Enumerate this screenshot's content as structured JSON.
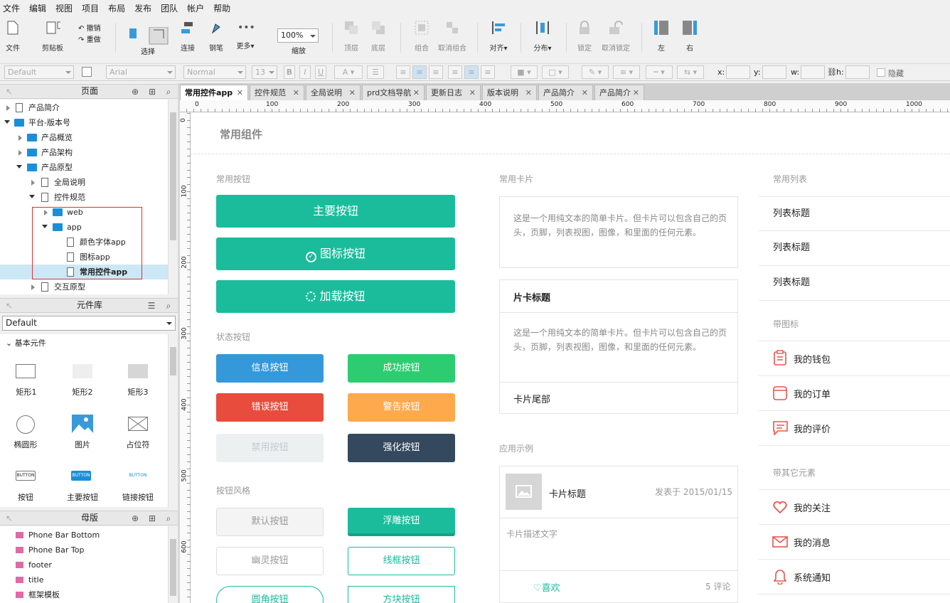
{
  "menu": [
    "文件",
    "编辑",
    "视图",
    "项目",
    "布局",
    "发布",
    "团队",
    "帐户",
    "帮助"
  ],
  "toolbar": {
    "file": "文件",
    "clipboard": "剪贴板",
    "undo": "撤销",
    "redo": "重做",
    "select": "选择",
    "connect": "连接",
    "pen": "钢笔",
    "more": "更多▾",
    "zoom_value": "100%",
    "zoom": "缩放",
    "top": "顶层",
    "bottom": "底层",
    "group": "组合",
    "ungroup": "取消组合",
    "align": "对齐▾",
    "distribute": "分布▾",
    "lock": "锁定",
    "unlock": "取消锁定",
    "left": "左",
    "right": "右"
  },
  "format": {
    "style": "Default",
    "font": "Arial",
    "weight": "Normal",
    "size": "13",
    "x_label": "x:",
    "y_label": "y:",
    "w_label": "w:",
    "h_label": "h:",
    "hide": "隐藏"
  },
  "pages_panel": {
    "title": "页面",
    "items": [
      {
        "label": "产品简介",
        "type": "page"
      },
      {
        "label": "平台-版本号",
        "type": "folder"
      },
      {
        "label": "产品概览",
        "type": "folder"
      },
      {
        "label": "产品架构",
        "type": "folder"
      },
      {
        "label": "产品原型",
        "type": "folder"
      },
      {
        "label": "全局说明",
        "type": "page"
      },
      {
        "label": "控件规范",
        "type": "page"
      },
      {
        "label": "web",
        "type": "folder"
      },
      {
        "label": "app",
        "type": "folder"
      },
      {
        "label": "颜色字体app",
        "type": "page"
      },
      {
        "label": "图标app",
        "type": "page"
      },
      {
        "label": "常用控件app",
        "type": "page"
      },
      {
        "label": "交互原型",
        "type": "page"
      }
    ]
  },
  "library_panel": {
    "title": "元件库",
    "selected": "Default",
    "group": "基本元件",
    "widgets": [
      "矩形1",
      "矩形2",
      "矩形3",
      "椭圆形",
      "图片",
      "占位符",
      "按钮",
      "主要按钮",
      "链接按钮"
    ],
    "btn_sample": "BUTTON"
  },
  "masters_panel": {
    "title": "母版",
    "items": [
      "Phone Bar Bottom",
      "Phone Bar Top",
      "footer",
      "title",
      "框架模板"
    ]
  },
  "tabs": [
    "常用控件app",
    "控件规范",
    "全局说明",
    "prd文档导航",
    "更新日志",
    "版本说明",
    "产品简介",
    "产品简介"
  ],
  "ruler_h": [
    "0",
    "100",
    "200",
    "300",
    "400",
    "500",
    "600",
    "700",
    "800",
    "900",
    "1000"
  ],
  "ruler_v": [
    "0",
    "100",
    "200",
    "300",
    "400",
    "500",
    "600"
  ],
  "canvas": {
    "title": "常用组件",
    "buttons_section": "常用按钮",
    "primary": "主要按钮",
    "icon_btn": "图标按钮",
    "loading_btn": "加载按钮",
    "state_section": "状态按钮",
    "info": "信息按钮",
    "success": "成功按钮",
    "error": "错误按钮",
    "warning": "警告按钮",
    "disabled": "禁用按钮",
    "emphasis": "强化按钮",
    "style_section": "按钮风格",
    "default_btn": "默认按钮",
    "raised_btn": "浮雕按钮",
    "ghost_btn": "幽灵按钮",
    "outline_btn": "线框按钮",
    "round_btn": "圆角按钮",
    "square_btn": "方块按钮",
    "cards_section": "常用卡片",
    "card_text": "这是一个用纯文本的简单卡片。但卡片可以包含自己的页头，页脚，列表视图，图像，和里面的任何元素。",
    "card_header": "片卡标题",
    "card_footer": "卡片尾部",
    "example_section": "应用示例",
    "ex_title": "卡片标题",
    "ex_date": "发表于 2015/01/15",
    "ex_desc": "卡片描述文字",
    "ex_like": "喜欢",
    "ex_comments": "5 评论",
    "list_section": "常用列表",
    "list_item": "列表标题",
    "icon_list_section": "带图标",
    "wallet": "我的钱包",
    "orders": "我的订单",
    "reviews": "我的评价",
    "other_section": "带其它元素",
    "follow": "我的关注",
    "messages": "我的消息",
    "notify": "系统通知"
  },
  "colors": {
    "primary": "#1abc9c",
    "info": "#3498db",
    "success": "#2ecc71",
    "error": "#e74c3c",
    "warning": "#ffa94d",
    "emphasis": "#34495e",
    "disabled": "#ecf0f1",
    "icon": "#e4574b"
  }
}
